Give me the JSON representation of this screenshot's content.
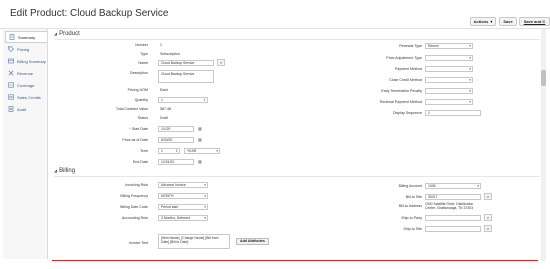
{
  "page": {
    "title": "Edit Product: Cloud Backup Service"
  },
  "toolbar": {
    "actions_label": "Actions",
    "save_label": "Save",
    "save_close_label": "Save and C"
  },
  "sidebar": {
    "items": [
      {
        "label": "Summary",
        "icon": "document-icon"
      },
      {
        "label": "Pricing",
        "icon": "price-tag-icon"
      },
      {
        "label": "Billing Summary",
        "icon": "billing-icon"
      },
      {
        "label": "Revenue",
        "icon": "revenue-icon"
      },
      {
        "label": "Coverage",
        "icon": "coverage-icon"
      },
      {
        "label": "Sales Credits",
        "icon": "credits-icon"
      },
      {
        "label": "Audit",
        "icon": "audit-icon"
      }
    ]
  },
  "product": {
    "section_title": "Product",
    "number_label": "Number",
    "number_value": "1",
    "type_label": "Type",
    "type_value": "Subscription",
    "name_label": "Name",
    "name_value": "Cloud Backup Service",
    "description_label": "Description",
    "description_value": "Cloud Backup Service",
    "pricing_uom_label": "Pricing UOM",
    "pricing_uom_value": "Each",
    "quantity_label": "Quantity",
    "quantity_value": "1",
    "total_contract_value_label": "Total Contract Value",
    "total_contract_value_value": "587.48",
    "status_label": "Status",
    "status_value": "Draft",
    "start_date_label": "Start Date",
    "start_date_value": "1/1/20",
    "price_as_of_date_label": "Price as of Date",
    "price_as_of_date_value": "6/30/20",
    "term_label": "Term",
    "term_value": "1",
    "term_unit_value": "YEAR",
    "end_date_label": "End Date",
    "end_date_value": "12/31/20",
    "renewal_type_label": "Renewal Type",
    "renewal_type_value": "Renew",
    "price_adjustment_type_label": "Price Adjustment Type",
    "payment_method_label": "Payment Method",
    "close_credit_method_label": "Close Credit Method",
    "early_termination_penalty_label": "Early Termination Penalty",
    "renewal_payment_method_label": "Renewal Payment Method",
    "display_sequence_label": "Display Sequence",
    "display_sequence_value": "1"
  },
  "billing": {
    "section_title": "Billing",
    "invoicing_rule_label": "Invoicing Rule",
    "invoicing_rule_value": "Advance Invoice",
    "billing_frequency_label": "Billing Frequency",
    "billing_frequency_value": "MONTH",
    "billing_date_code_label": "Billing Date Code",
    "billing_date_code_value": "Period start",
    "accounting_rule_label": "Accounting Rule",
    "accounting_rule_value": "3 Months, Deferred",
    "invoice_text_label": "Invoice Text",
    "invoice_text_value": "[Item Name], [Charge Name] [Bill from Date] [Bill to Date]",
    "add_attributes_label": "Add Attributes",
    "billing_account_label": "Billing Account",
    "billing_account_value": "1006",
    "bill_to_site_label": "Bill-to Site",
    "bill_to_site_value": "30017",
    "bill_to_address_label": "Bill-to Address",
    "bill_to_address_value": "1900 Satellite Drive, Distribution Center, Chattanooga, TN 37403",
    "ship_to_party_label": "Ship-to Party",
    "ship_to_site_label": "Ship-to Site"
  }
}
